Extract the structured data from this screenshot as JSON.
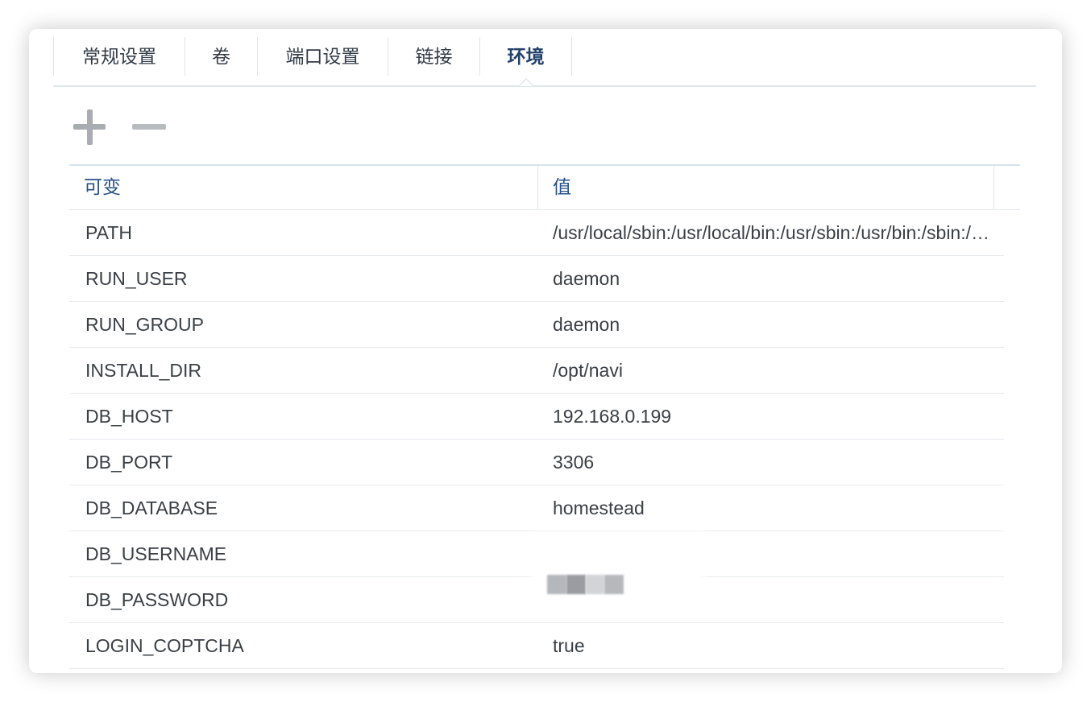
{
  "tabs": [
    {
      "label": "常规设置",
      "active": false
    },
    {
      "label": "卷",
      "active": false
    },
    {
      "label": "端口设置",
      "active": false
    },
    {
      "label": "链接",
      "active": false
    },
    {
      "label": "环境",
      "active": true
    }
  ],
  "toolbar": {
    "add_icon": "plus-icon",
    "remove_icon": "minus-icon"
  },
  "table": {
    "headers": {
      "variable": "可变",
      "value": "值"
    },
    "rows": [
      {
        "name": "PATH",
        "value": "/usr/local/sbin:/usr/local/bin:/usr/sbin:/usr/bin:/sbin:/bin"
      },
      {
        "name": "RUN_USER",
        "value": "daemon"
      },
      {
        "name": "RUN_GROUP",
        "value": "daemon"
      },
      {
        "name": "INSTALL_DIR",
        "value": "/opt/navi"
      },
      {
        "name": "DB_HOST",
        "value": "192.168.0.199"
      },
      {
        "name": "DB_PORT",
        "value": "3306"
      },
      {
        "name": "DB_DATABASE",
        "value": "homestead"
      },
      {
        "name": "DB_USERNAME",
        "value": ""
      },
      {
        "name": "DB_PASSWORD",
        "value": ""
      },
      {
        "name": "LOGIN_COPTCHA",
        "value": "true"
      }
    ]
  },
  "colors": {
    "active_tab": "#23426a",
    "header_text": "#25508a",
    "body_text": "#3a3f46",
    "icon_gray": "#a9adb3"
  }
}
